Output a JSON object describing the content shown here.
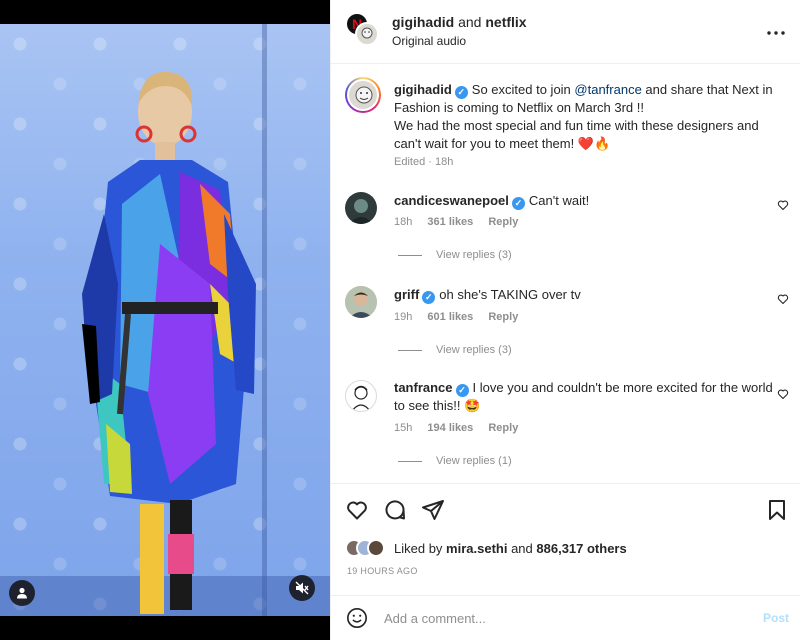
{
  "header": {
    "username": "gigihadid",
    "conjunction": "and",
    "collaborator": "netflix",
    "audio": "Original audio",
    "more_icon": "more-horizontal-icon"
  },
  "caption": {
    "username": "gigihadid",
    "text_before_mention": "So excited to join ",
    "mention": "@tanfrance",
    "text_after_mention": " and share that Next in Fashion is coming to Netflix on March 3rd !!",
    "line2": "We had the most special and fun time with these designers and can't wait for you to meet them! ❤️🔥",
    "edited": "Edited · 18h"
  },
  "comments": [
    {
      "username": "candiceswanepoel",
      "text": "Can't wait!",
      "time": "18h",
      "likes": "361 likes",
      "reply": "Reply",
      "view_replies": "View replies (3)"
    },
    {
      "username": "griff",
      "text": "oh she's TAKING over tv",
      "time": "19h",
      "likes": "601 likes",
      "reply": "Reply",
      "view_replies": "View replies (3)"
    },
    {
      "username": "tanfrance",
      "text": "I love you and couldn't be more excited for the world to see this!! 🤩",
      "time": "15h",
      "likes": "194 likes",
      "reply": "Reply",
      "view_replies": "View replies (1)"
    }
  ],
  "likes": {
    "prefix": "Liked by ",
    "user": "mira.sethi",
    "middle": " and ",
    "count": "886,317 others"
  },
  "timestamp": "19 HOURS AGO",
  "add_comment": {
    "placeholder": "Add a comment...",
    "post_label": "Post"
  },
  "colors": {
    "verified": "#3897f0",
    "post_disabled": "#b2dffc",
    "muted_text": "#8e8e8e"
  }
}
